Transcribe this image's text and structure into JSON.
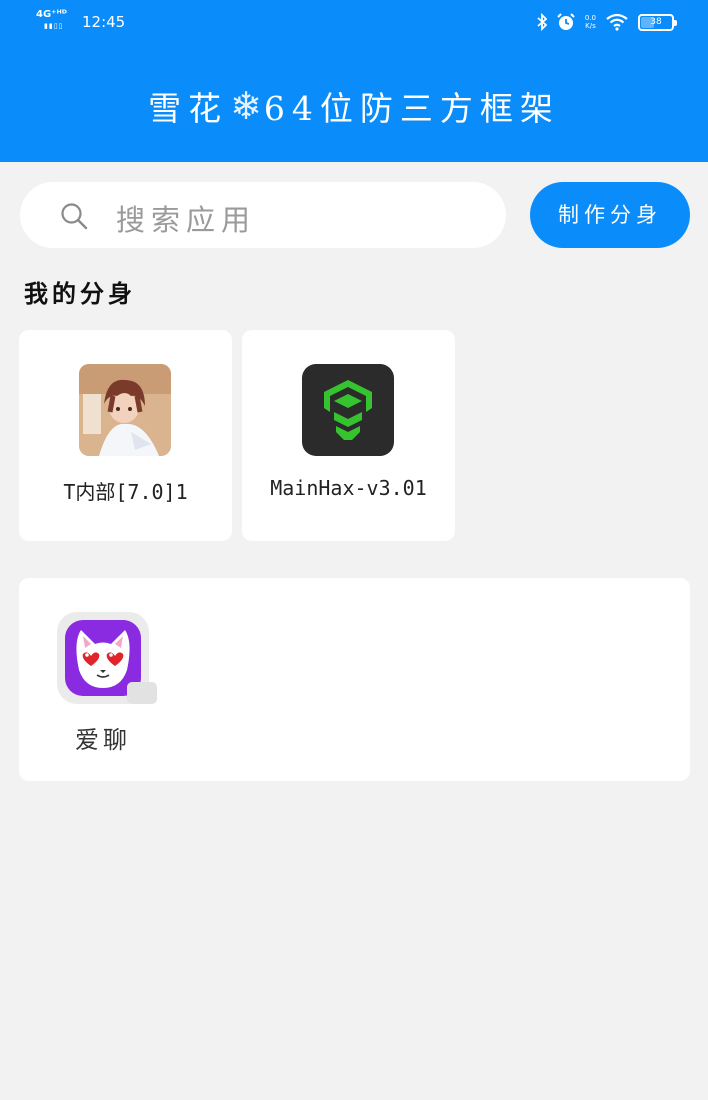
{
  "status_bar": {
    "network": "4G⁺ᴴᴰ",
    "signal": "▮▮▯▯",
    "time": "12:45",
    "net_speed_top": "0.0",
    "net_speed_bottom": "K/s",
    "battery": "38",
    "icons": [
      "bluetooth-icon",
      "alarm-icon",
      "wifi-icon",
      "battery-icon"
    ]
  },
  "header": {
    "title_left": "雪花",
    "snowflake": "❄",
    "title_right": "64位防三方框架"
  },
  "search": {
    "placeholder": "搜索应用"
  },
  "make_button": {
    "label": "制作分身"
  },
  "section": {
    "title": "我的分身"
  },
  "clones": [
    {
      "label": "T内部[7.0]1",
      "icon": "anime-avatar-icon"
    },
    {
      "label": "MainHax-v3.01",
      "icon": "mainhax-logo-icon"
    }
  ],
  "installed_apps": [
    {
      "label": "爱聊",
      "icon": "cat-heart-eyes-icon"
    }
  ],
  "colors": {
    "primary": "#0a8cfa",
    "background": "#f2f2f2",
    "card": "#ffffff",
    "mainhax_bg": "#2b2b2b",
    "mainhax_green": "#35c42f",
    "ailiao_purple": "#8a2be2"
  }
}
